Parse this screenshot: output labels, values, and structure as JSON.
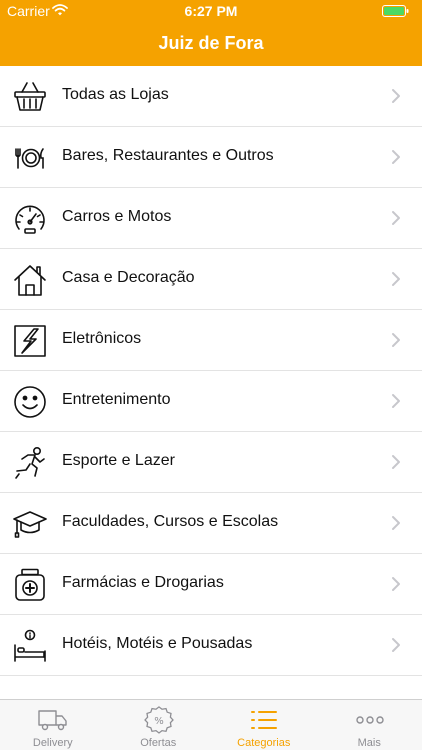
{
  "status_bar": {
    "carrier": "Carrier",
    "time": "6:27 PM"
  },
  "nav": {
    "title": "Juiz de Fora"
  },
  "colors": {
    "accent": "#F5A200",
    "tab_inactive": "#8e8e93",
    "battery": "#4CD964"
  },
  "categories": [
    {
      "label": "Todas as Lojas",
      "icon": "basket-icon"
    },
    {
      "label": "Bares, Restaurantes e Outros",
      "icon": "plate-cutlery-icon"
    },
    {
      "label": "Carros e Motos",
      "icon": "speedometer-icon"
    },
    {
      "label": "Casa e Decoração",
      "icon": "house-icon"
    },
    {
      "label": "Eletrônicos",
      "icon": "lightning-box-icon"
    },
    {
      "label": "Entretenimento",
      "icon": "smiley-icon"
    },
    {
      "label": "Esporte e Lazer",
      "icon": "runner-icon"
    },
    {
      "label": "Faculdades, Cursos e Escolas",
      "icon": "graduation-cap-icon"
    },
    {
      "label": "Farmácias e Drogarias",
      "icon": "pharmacy-jar-icon"
    },
    {
      "label": "Hotéis, Motéis e Pousadas",
      "icon": "bed-icon"
    },
    {
      "label": "",
      "icon": "clock-icon"
    }
  ],
  "tabs": [
    {
      "label": "Delivery",
      "icon": "delivery-truck-icon",
      "active": false
    },
    {
      "label": "Ofertas",
      "icon": "percent-badge-icon",
      "active": false
    },
    {
      "label": "Categorias",
      "icon": "list-icon",
      "active": true
    },
    {
      "label": "Mais",
      "icon": "more-dots-icon",
      "active": false
    }
  ]
}
